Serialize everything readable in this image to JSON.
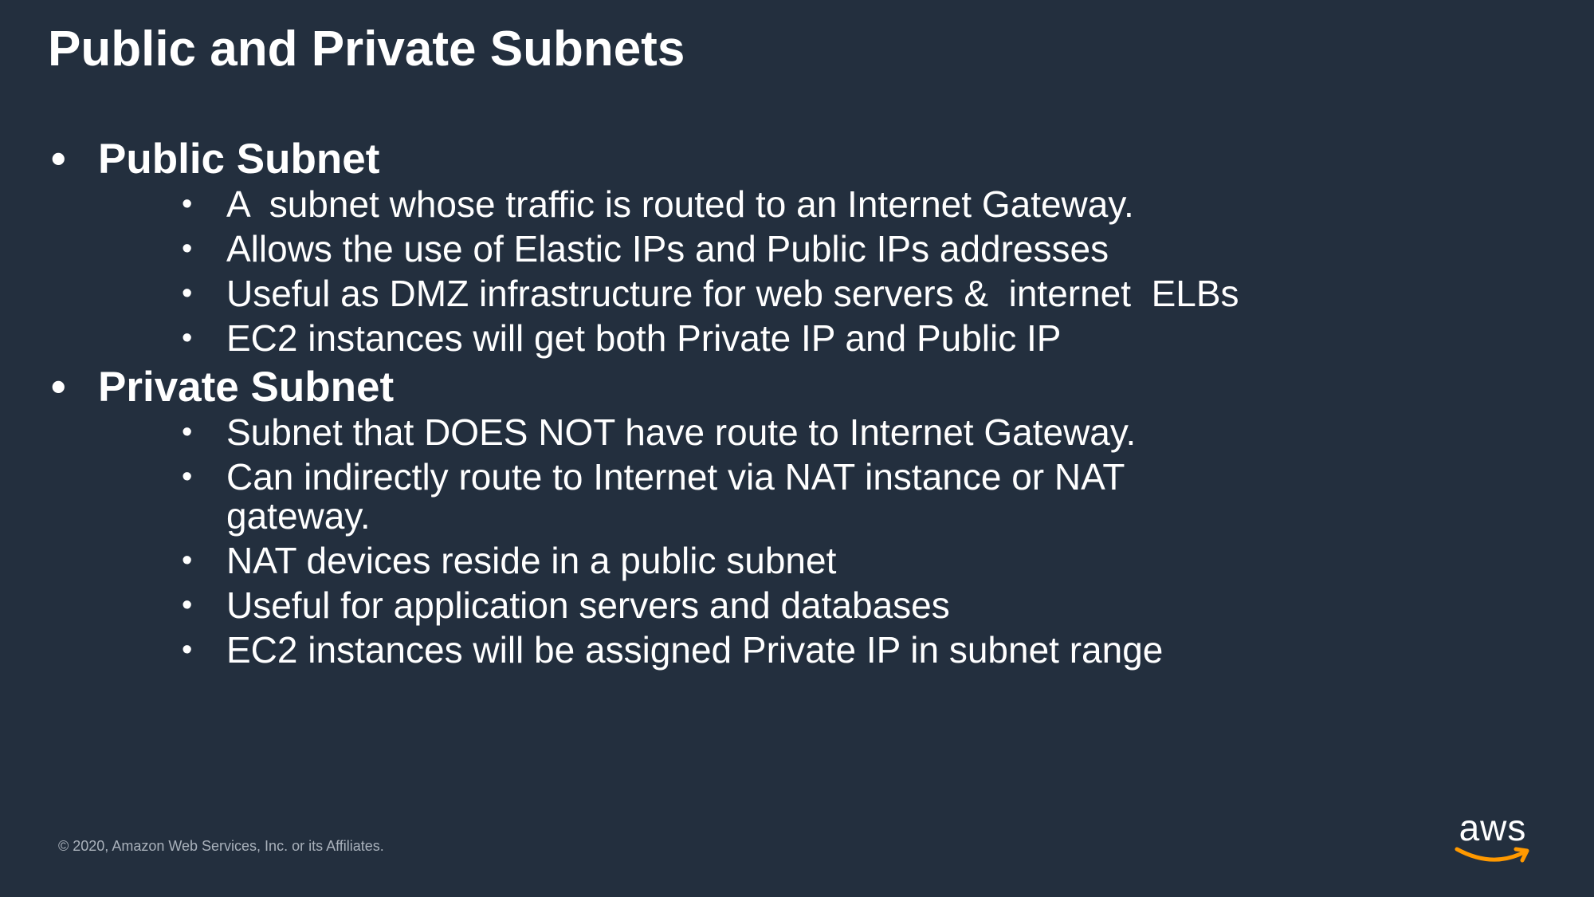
{
  "slide": {
    "title": "Public and Private Subnets",
    "sections": [
      {
        "heading": "Public Subnet",
        "bullets": [
          "A  subnet whose traffic is routed to an Internet Gateway.",
          "Allows the use of Elastic IPs and Public IPs addresses",
          "Useful as DMZ infrastructure for web servers &  internet  ELBs",
          "EC2 instances will get both Private IP and Public IP"
        ]
      },
      {
        "heading": "Private Subnet",
        "bullets": [
          "Subnet that DOES NOT have route to Internet Gateway.",
          "Can indirectly route to Internet via NAT instance or NAT gateway.",
          "NAT devices reside in a public subnet",
          "Useful for application servers and databases",
          "EC2 instances will be assigned Private IP in subnet range"
        ]
      }
    ],
    "bullet_char": "•",
    "footer": "© 2020, Amazon Web Services, Inc. or its Affiliates.",
    "logo_text": "aws",
    "colors": {
      "background": "#232f3e",
      "text": "#ffffff",
      "footer": "#a9b1bb",
      "logo_smile": "#ff9900"
    }
  }
}
